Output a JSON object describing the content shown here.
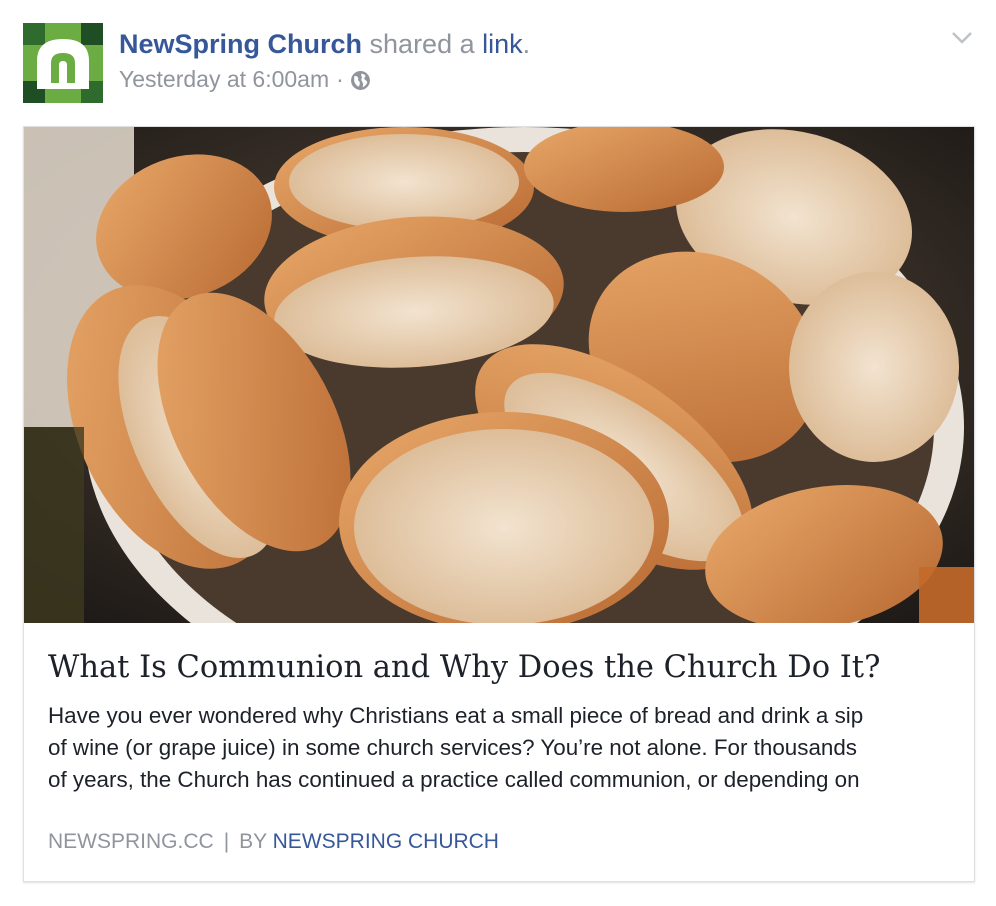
{
  "post": {
    "page_name": "NewSpring Church",
    "shared_text": "shared a",
    "link_text": "link",
    "period": ".",
    "timestamp": "Yesterday at 6:00am",
    "dot": "·",
    "privacy_icon": "globe-icon",
    "options_icon": "chevron-down-icon"
  },
  "link_card": {
    "title": "What Is Communion and Why Does the Church Do It?",
    "description_lines": [
      "Have you ever wondered why Christians eat a small piece of bread and drink a sip",
      "of wine (or grape juice) in some church services? You’re not alone. For thousands",
      "of years, the Church has continued a practice called communion, or depending on"
    ],
    "source_domain": "NEWSPRING.CC",
    "separator": "|",
    "by_label": "BY",
    "author": "NEWSPRING CHURCH"
  },
  "colors": {
    "link_blue": "#365899",
    "meta_gray": "#90949c",
    "brand_green": "#6bac43"
  }
}
